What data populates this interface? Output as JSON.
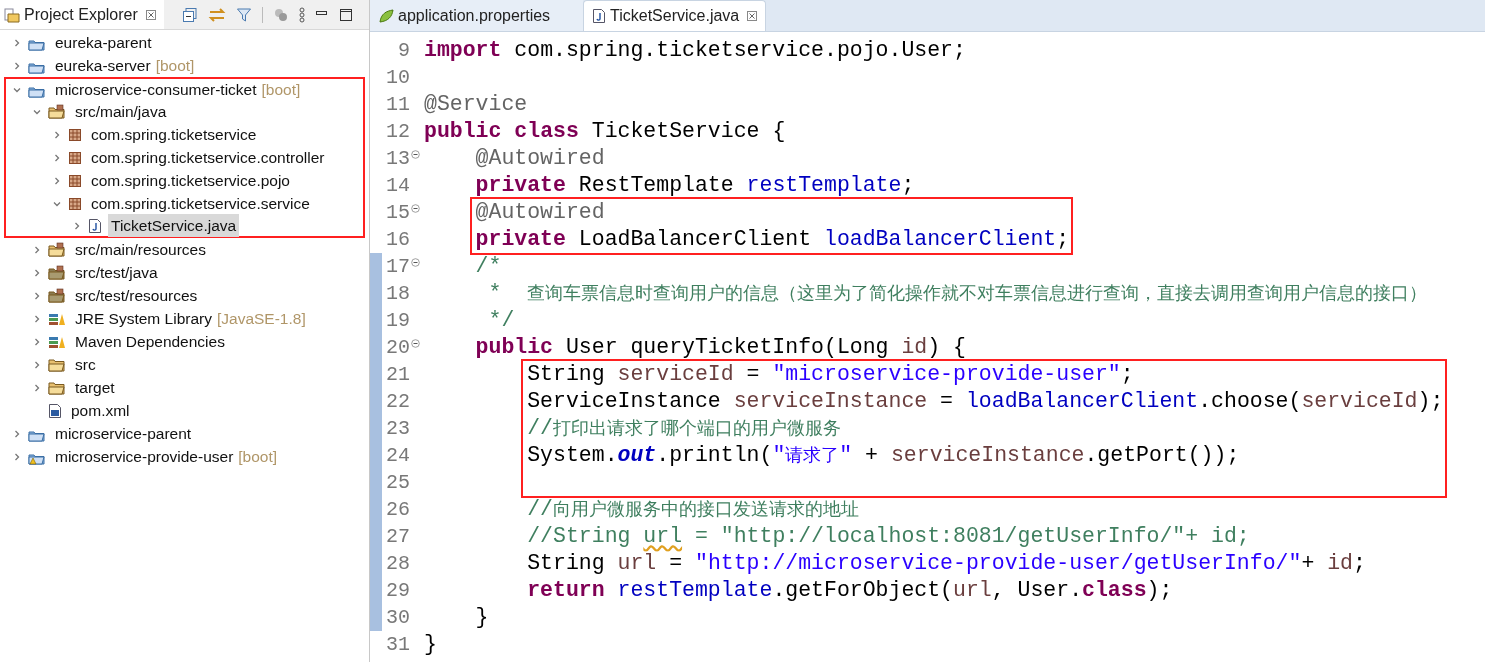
{
  "explorer": {
    "title": "Project Explorer",
    "tree": [
      {
        "label": "eureka-parent",
        "kind": "maven-project",
        "expanded": false,
        "selected": false
      },
      {
        "label": "eureka-server",
        "decoration": "[boot]",
        "kind": "boot-project",
        "expanded": false,
        "selected": false
      },
      {
        "label": "microservice-consumer-ticket",
        "decoration": "[boot]",
        "kind": "boot-project",
        "expanded": true,
        "selected": false,
        "highlighted": true,
        "children": [
          {
            "label": "src/main/java",
            "kind": "source-folder",
            "expanded": true,
            "selected": false,
            "highlighted": true,
            "children": [
              {
                "label": "com.spring.ticketservice",
                "kind": "package",
                "expanded": false,
                "selected": false,
                "highlighted": true
              },
              {
                "label": "com.spring.ticketservice.controller",
                "kind": "package",
                "expanded": false,
                "selected": false,
                "highlighted": true
              },
              {
                "label": "com.spring.ticketservice.pojo",
                "kind": "package",
                "expanded": false,
                "selected": false,
                "highlighted": true
              },
              {
                "label": "com.spring.ticketservice.service",
                "kind": "package",
                "expanded": true,
                "selected": false,
                "highlighted": true,
                "children": [
                  {
                    "label": "TicketService.java",
                    "kind": "java-file",
                    "expanded": false,
                    "selected": true,
                    "highlighted": true
                  }
                ]
              }
            ]
          },
          {
            "label": "src/main/resources",
            "kind": "source-folder",
            "expanded": false,
            "selected": false
          },
          {
            "label": "src/test/java",
            "kind": "test-folder",
            "expanded": false,
            "selected": false
          },
          {
            "label": "src/test/resources",
            "kind": "test-folder",
            "expanded": false,
            "selected": false
          },
          {
            "label": "JRE System Library",
            "decoration": "[JavaSE-1.8]",
            "kind": "library",
            "expanded": false,
            "selected": false
          },
          {
            "label": "Maven Dependencies",
            "kind": "library",
            "expanded": false,
            "selected": false
          },
          {
            "label": "src",
            "kind": "folder",
            "expanded": false,
            "selected": false
          },
          {
            "label": "target",
            "kind": "folder",
            "expanded": false,
            "selected": false
          },
          {
            "label": "pom.xml",
            "kind": "xml-file",
            "selected": false
          }
        ]
      },
      {
        "label": "microservice-parent",
        "kind": "maven-project",
        "expanded": false,
        "selected": false
      },
      {
        "label": "microservice-provide-user",
        "decoration": "[boot]",
        "kind": "boot-warning-project",
        "expanded": false,
        "selected": false
      }
    ]
  },
  "editor": {
    "tabs": [
      {
        "label": "application.properties",
        "kind": "properties-file",
        "selected": false
      },
      {
        "label": "TicketService.java",
        "kind": "java-file",
        "selected": true
      }
    ],
    "lines": [
      {
        "number": "9",
        "tokens": [
          {
            "kind": "kw",
            "t": "import"
          },
          {
            "kind": "p",
            "t": " com.spring.ticketservice.pojo.User;"
          }
        ]
      },
      {
        "number": "10"
      },
      {
        "number": "11",
        "tokens": [
          {
            "kind": "ann",
            "t": "@Service"
          }
        ]
      },
      {
        "number": "12",
        "tokens": [
          {
            "kind": "kw",
            "t": "public "
          },
          {
            "kind": "kw",
            "t": "class"
          },
          {
            "kind": "p",
            "t": " TicketService {"
          }
        ]
      },
      {
        "number": "13",
        "fold": true,
        "tokens": [
          {
            "kind": "ann",
            "t": "    @Autowired"
          }
        ]
      },
      {
        "number": "14",
        "tokens": [
          {
            "kind": "kw",
            "t": "    private"
          },
          {
            "kind": "p",
            "t": " RestTemplate "
          },
          {
            "kind": "field",
            "t": "restTemplate"
          },
          {
            "kind": "p",
            "t": ";"
          }
        ]
      },
      {
        "number": "15",
        "fold": true,
        "highlighted": true,
        "tokens": [
          {
            "kind": "ann",
            "t": "    @Autowired"
          }
        ]
      },
      {
        "number": "16",
        "highlighted": true,
        "tokens": [
          {
            "kind": "kw",
            "t": "    private"
          },
          {
            "kind": "p",
            "t": " LoadBalancerClient "
          },
          {
            "kind": "field",
            "t": "loadBalancerClient"
          },
          {
            "kind": "p",
            "t": ";"
          }
        ]
      },
      {
        "number": "17",
        "fold": true,
        "changed": true,
        "tokens": [
          {
            "kind": "cmt",
            "t": "    /*"
          }
        ]
      },
      {
        "number": "18",
        "changed": true,
        "tokens": [
          {
            "kind": "cmt",
            "t": "     *  "
          },
          {
            "kind": "cmt_cjk",
            "t": "查询车票信息时查询用户的信息（这里为了简化操作就不对车票信息进行查询，直接去调用查询用户信息的接口）"
          }
        ]
      },
      {
        "number": "19",
        "changed": true,
        "tokens": [
          {
            "kind": "cmt",
            "t": "     */"
          }
        ]
      },
      {
        "number": "20",
        "fold": true,
        "changed": true,
        "tokens": [
          {
            "kind": "kw",
            "t": "    public"
          },
          {
            "kind": "p",
            "t": " User queryTicketInfo(Long "
          },
          {
            "kind": "local",
            "t": "id"
          },
          {
            "kind": "p",
            "t": ") {"
          }
        ]
      },
      {
        "number": "21",
        "changed": true,
        "highlighted": true,
        "tokens": [
          {
            "kind": "p",
            "t": "        String "
          },
          {
            "kind": "local",
            "t": "serviceId"
          },
          {
            "kind": "p",
            "t": " = "
          },
          {
            "kind": "str",
            "t": "\"microservice-provide-user\""
          },
          {
            "kind": "p",
            "t": ";"
          }
        ]
      },
      {
        "number": "22",
        "changed": true,
        "highlighted": true,
        "tokens": [
          {
            "kind": "p",
            "t": "        ServiceInstance "
          },
          {
            "kind": "local",
            "t": "serviceInstance"
          },
          {
            "kind": "p",
            "t": " = "
          },
          {
            "kind": "field",
            "t": "loadBalancerClient"
          },
          {
            "kind": "p",
            "t": ".choose("
          },
          {
            "kind": "local",
            "t": "serviceId"
          },
          {
            "kind": "p",
            "t": ");"
          }
        ]
      },
      {
        "number": "23",
        "changed": true,
        "highlighted": true,
        "tokens": [
          {
            "kind": "cmt",
            "t": "        //"
          },
          {
            "kind": "cmt_cjk",
            "t": "打印出请求了哪个端口的用户微服务"
          }
        ]
      },
      {
        "number": "24",
        "changed": true,
        "highlighted": true,
        "tokens": [
          {
            "kind": "p",
            "t": "        System."
          },
          {
            "kind": "static",
            "t": "out"
          },
          {
            "kind": "p",
            "t": ".println("
          },
          {
            "kind": "str",
            "t": "\""
          },
          {
            "kind": "str_cjk",
            "t": "请求了"
          },
          {
            "kind": "str",
            "t": "\""
          },
          {
            "kind": "p",
            "t": " + "
          },
          {
            "kind": "local",
            "t": "serviceInstance"
          },
          {
            "kind": "p",
            "t": ".getPort());"
          }
        ]
      },
      {
        "number": "25",
        "changed": true,
        "highlighted": true
      },
      {
        "number": "26",
        "changed": true,
        "tokens": [
          {
            "kind": "cmt",
            "t": "        //"
          },
          {
            "kind": "cmt_cjk",
            "t": "向用户微服务中的接口发送请求的地址"
          }
        ]
      },
      {
        "number": "27",
        "changed": true,
        "tokens": [
          {
            "kind": "cmt",
            "t": "        //String "
          },
          {
            "kind": "cmt_warn",
            "t": "url"
          },
          {
            "kind": "cmt",
            "t": " = \"http://localhost:8081/getUserInfo/\"+ id;"
          }
        ]
      },
      {
        "number": "28",
        "changed": true,
        "tokens": [
          {
            "kind": "p",
            "t": "        String "
          },
          {
            "kind": "local",
            "t": "url"
          },
          {
            "kind": "p",
            "t": " = "
          },
          {
            "kind": "str",
            "t": "\"http://microservice-provide-user/getUserInfo/\""
          },
          {
            "kind": "p",
            "t": "+ "
          },
          {
            "kind": "local",
            "t": "id"
          },
          {
            "kind": "p",
            "t": ";"
          }
        ]
      },
      {
        "number": "29",
        "changed": true,
        "tokens": [
          {
            "kind": "kw",
            "t": "        return"
          },
          {
            "kind": "field",
            "t": " restTemplate"
          },
          {
            "kind": "p",
            "t": ".getForObject("
          },
          {
            "kind": "local",
            "t": "url"
          },
          {
            "kind": "p",
            "t": ", User."
          },
          {
            "kind": "kw",
            "t": "class"
          },
          {
            "kind": "p",
            "t": ");"
          }
        ]
      },
      {
        "number": "30",
        "changed": true,
        "tokens": [
          {
            "kind": "p",
            "t": "    }"
          }
        ]
      },
      {
        "number": "31",
        "tokens": [
          {
            "kind": "p",
            "t": "}"
          }
        ]
      }
    ]
  }
}
